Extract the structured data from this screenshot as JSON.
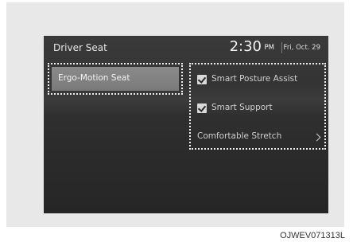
{
  "header": {
    "title": "Driver Seat",
    "time": "2:30",
    "ampm": "PM",
    "date": "Fri, Oct. 29"
  },
  "left_menu": {
    "items": [
      {
        "label": "Ergo-Motion Seat"
      }
    ]
  },
  "options": {
    "items": [
      {
        "label": "Smart Posture Assist",
        "checked": true
      },
      {
        "label": "Smart Support",
        "checked": true
      },
      {
        "label": "Comfortable Stretch"
      }
    ]
  },
  "figure_code": "OJWEV071313L"
}
